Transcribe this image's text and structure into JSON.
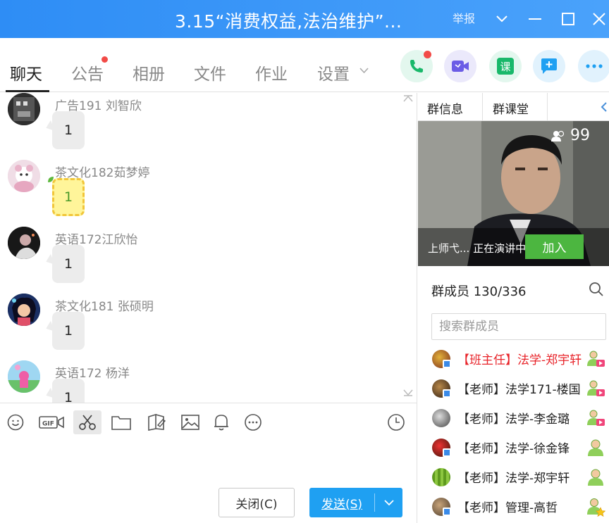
{
  "window": {
    "title": "3.15“消费权益,法治维护”...",
    "report": "举报"
  },
  "tabs": [
    {
      "label": "聊天"
    },
    {
      "label": "公告"
    },
    {
      "label": "相册"
    },
    {
      "label": "文件"
    },
    {
      "label": "作业"
    },
    {
      "label": "设置"
    }
  ],
  "colors": {
    "accent": "#1fa0f2",
    "titlebar": "#3b98f8",
    "join": "#4cb640",
    "red_name": "#e8242a"
  },
  "messages": [
    {
      "sender": "广告191 刘智欣",
      "text": "1"
    },
    {
      "sender": "茶文化182茹梦婷",
      "text": "1"
    },
    {
      "sender": "英语172江欣怡",
      "text": "1"
    },
    {
      "sender": "茶文化181 张硕明",
      "text": "1"
    },
    {
      "sender": "英语172 杨洋",
      "text": "1"
    }
  ],
  "compose": {
    "close_label": "关闭(C)",
    "send_label": "发送(S)"
  },
  "right_panel": {
    "tabs": [
      {
        "label": "群信息"
      },
      {
        "label": "群课堂"
      }
    ],
    "video": {
      "viewer_count": "99",
      "status_text": "上师弋... 正在演讲中",
      "join_label": "加入"
    },
    "members_header": "群成员 130/336",
    "search_placeholder": "搜索群成员",
    "members": [
      {
        "name": "【班主任】法学-郑宇轩"
      },
      {
        "name": "【老师】法学171-楼国"
      },
      {
        "name": "【老师】法学-李金璐"
      },
      {
        "name": "【老师】法学-徐金锋"
      },
      {
        "name": "【老师】法学-郑宇轩"
      },
      {
        "name": "【老师】管理-高哲"
      }
    ]
  }
}
